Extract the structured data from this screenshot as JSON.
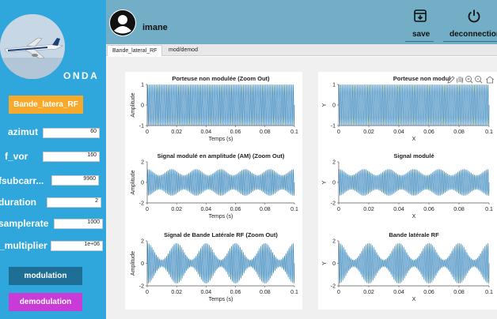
{
  "sidebar": {
    "brand": "ONDA",
    "bande_button": "Bande_latera_RF",
    "params": [
      {
        "label": "azimut",
        "value": "60"
      },
      {
        "label": "f_vor",
        "value": "160"
      },
      {
        "label": "fsubcarr...",
        "value": "9960"
      },
      {
        "label": "duration",
        "value": "2"
      },
      {
        "label": "samplerate",
        "value": "1000"
      },
      {
        "label": "_multiplier",
        "value": "1e+06"
      }
    ],
    "modulation_button": "modulation",
    "demodulation_button": "demodulation"
  },
  "header": {
    "username": "imane",
    "save_label": "save",
    "disconnect_label": "deconnection"
  },
  "tabs": [
    {
      "label": "Bande_lateral_RF",
      "active": true
    },
    {
      "label": "mod/demod",
      "active": false
    }
  ],
  "colors": {
    "sidebar": "#2fa6dc",
    "header": "#72afc6",
    "signal": "#1f77b4",
    "bande_button": "#f7a92c",
    "modulation_button": "#1e6e96",
    "demodulation_button": "#c93bd6"
  },
  "chart_data": [
    {
      "type": "line",
      "title": "Porteuse non modulée (Zoom Out)",
      "xlabel": "Temps (s)",
      "ylabel": "Amplitude",
      "xlim": [
        0,
        0.1
      ],
      "ylim": [
        -1,
        1
      ],
      "x_ticks": [
        "0",
        "0.02",
        "0.04",
        "0.06",
        "0.08",
        "0.1"
      ],
      "y_ticks": [
        "1",
        "0",
        "-1"
      ],
      "series": [
        {
          "signal": "carrier",
          "amplitude": 1
        }
      ]
    },
    {
      "type": "line",
      "title": "Porteuse non modul",
      "xlabel": "X",
      "ylabel": "Y",
      "xlim": [
        0,
        0.1
      ],
      "ylim": [
        -1,
        1
      ],
      "x_ticks": [
        "0",
        "0.02",
        "0.04",
        "0.06",
        "0.08",
        "0.1"
      ],
      "y_ticks": [
        "1",
        "0",
        "-1"
      ],
      "series": [
        {
          "signal": "carrier",
          "amplitude": 1
        }
      ]
    },
    {
      "type": "line",
      "title": "Signal modulé en amplitude (AM) (Zoom Out)",
      "xlabel": "Temps (s)",
      "ylabel": "Amplitude",
      "xlim": [
        0,
        0.1
      ],
      "ylim": [
        -2,
        2
      ],
      "x_ticks": [
        "0",
        "0.02",
        "0.04",
        "0.06",
        "0.08",
        "0.1"
      ],
      "y_ticks": [
        "2",
        "0",
        "-2"
      ],
      "series": [
        {
          "signal": "am",
          "envelope_min": 0.7,
          "envelope_max": 1.3
        }
      ]
    },
    {
      "type": "line",
      "title": "Signal modulé",
      "xlabel": "X",
      "ylabel": "Y",
      "xlim": [
        0,
        0.1
      ],
      "ylim": [
        -2,
        2
      ],
      "x_ticks": [
        "0",
        "0.02",
        "0.04",
        "0.06",
        "0.08",
        "0.1"
      ],
      "y_ticks": [
        "2",
        "0",
        "-2"
      ],
      "series": [
        {
          "signal": "am",
          "envelope_min": 0.7,
          "envelope_max": 1.3
        }
      ]
    },
    {
      "type": "line",
      "title": "Signal de Bande Latérale RF (Zoom Out)",
      "xlabel": "Temps (s)",
      "ylabel": "Amplitude",
      "xlim": [
        0,
        0.1
      ],
      "ylim": [
        -2,
        2
      ],
      "x_ticks": [
        "0",
        "0.02",
        "0.04",
        "0.06",
        "0.08",
        "0.1"
      ],
      "y_ticks": [
        "2",
        "0",
        "-2"
      ],
      "series": [
        {
          "signal": "sideband",
          "envelope_min": 0.3,
          "envelope_max": 1.8
        }
      ]
    },
    {
      "type": "line",
      "title": "Bande latérale RF",
      "xlabel": "X",
      "ylabel": "Y",
      "xlim": [
        0,
        0.1
      ],
      "ylim": [
        -2,
        2
      ],
      "x_ticks": [
        "0",
        "0.02",
        "0.04",
        "0.06",
        "0.08",
        "0.1"
      ],
      "y_ticks": [
        "2",
        "0",
        "-2"
      ],
      "series": [
        {
          "signal": "sideband",
          "envelope_min": 0.3,
          "envelope_max": 1.8
        }
      ]
    }
  ]
}
